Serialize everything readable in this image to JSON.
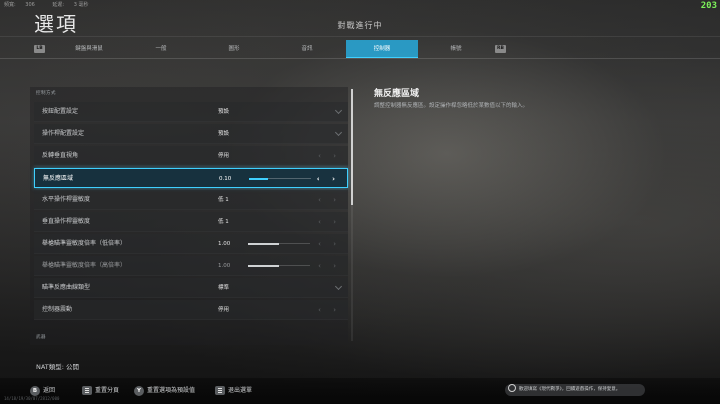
{
  "top_stats": {
    "latency_label": "頻寬:",
    "latency_value": "306",
    "tick_label": "延遲:",
    "tick_value": "3 毫秒"
  },
  "fps": "203",
  "page_title": "選項",
  "match_status": "對戰進行中",
  "tabs": {
    "lb": "LB",
    "rb": "RB",
    "items": [
      {
        "label": "鍵盤與滑鼠",
        "active": false
      },
      {
        "label": "一般",
        "active": false
      },
      {
        "label": "圖形",
        "active": false
      },
      {
        "label": "音訊",
        "active": false
      },
      {
        "label": "控制器",
        "active": true
      },
      {
        "label": "帳號",
        "active": false
      }
    ]
  },
  "sections": {
    "controls": "控制方式",
    "weapons": "武器"
  },
  "settings": [
    {
      "label": "按鈕配置設定",
      "value": "預設",
      "control": "dropdown"
    },
    {
      "label": "操作桿配置設定",
      "value": "預設",
      "control": "dropdown"
    },
    {
      "label": "反轉垂直視角",
      "value": "停用",
      "control": "toggle"
    },
    {
      "label": "無反應區域",
      "value": "0.10",
      "control": "slider",
      "level": 0.3,
      "selected": true
    },
    {
      "label": "水平操作桿靈敏度",
      "value": "低 1",
      "control": "toggle"
    },
    {
      "label": "垂直操作桿靈敏度",
      "value": "低 1",
      "control": "toggle"
    },
    {
      "label": "舉槍瞄準靈敏度倍率（低倍率）",
      "value": "1.00",
      "control": "slider",
      "level": 0.5
    },
    {
      "label": "舉槍瞄準靈敏度倍率（高倍率）",
      "value": "1.00",
      "control": "slider",
      "level": 0.5,
      "dim": true
    },
    {
      "label": "瞄準反應曲線類型",
      "value": "標準",
      "control": "dropdown"
    },
    {
      "label": "控制器震動",
      "value": "停用",
      "control": "toggle"
    }
  ],
  "nat": {
    "label": "NAT類型:",
    "value": "公開"
  },
  "description": {
    "title": "無反應區域",
    "text": "調整控制器無反應區。設定操作桿忽略低於某數值以下的輸入。"
  },
  "footer": {
    "back": {
      "key": "B",
      "label": "返回"
    },
    "reset_tab": {
      "label": "重置分頁"
    },
    "reset_all": {
      "key": "Y",
      "label": "重置選項為預設值"
    },
    "exit": {
      "label": "退出選單"
    },
    "feedback": "歡迎填寫《現代戰爭》，回饋遊戲操作，保持愛意。"
  },
  "build_id": "14/18/19/30/07/2812/000"
}
